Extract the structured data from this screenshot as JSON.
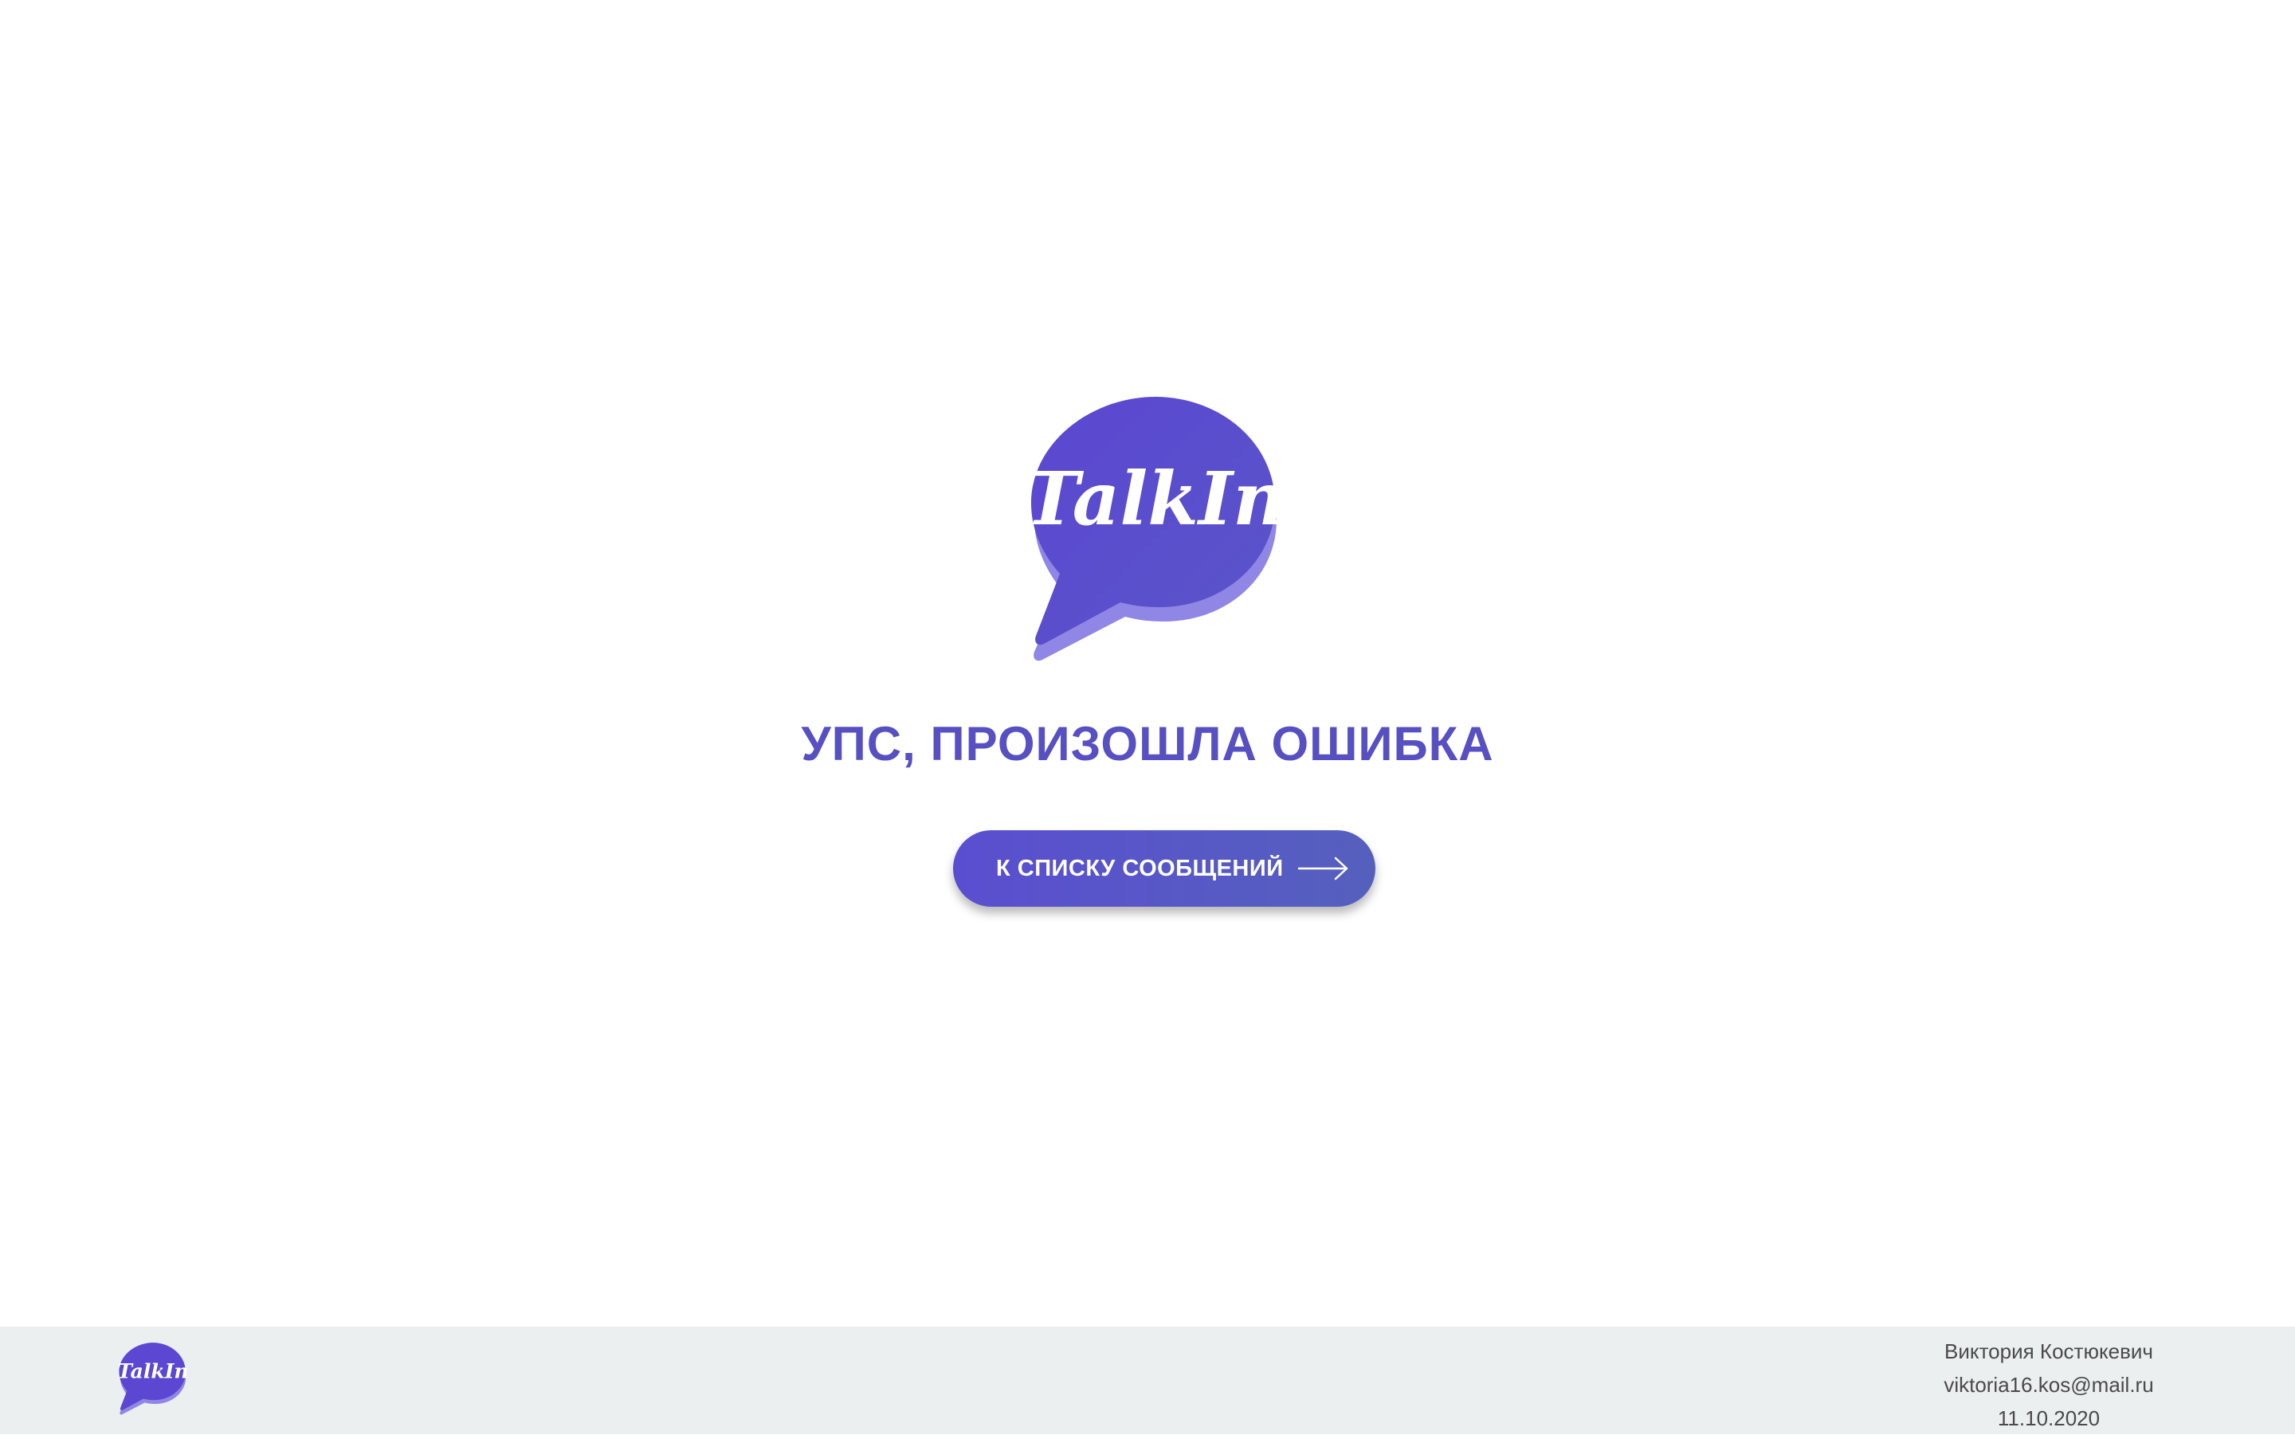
{
  "brand": {
    "name": "TalkIn",
    "primary_color": "#5a4ed0",
    "shadow_color": "#8f86e6"
  },
  "error": {
    "title": "УПС, ПРОИЗОШЛА ОШИБКА",
    "color": "#5750c2"
  },
  "back_button": {
    "label": "К СПИСКУ СООБЩЕНИЙ",
    "icon": "arrow-right-icon"
  },
  "footer": {
    "author": "Виктория Костюкевич",
    "email": "viktoria16.kos@mail.ru",
    "date": "11.10.2020",
    "background": "#ebeff0"
  }
}
